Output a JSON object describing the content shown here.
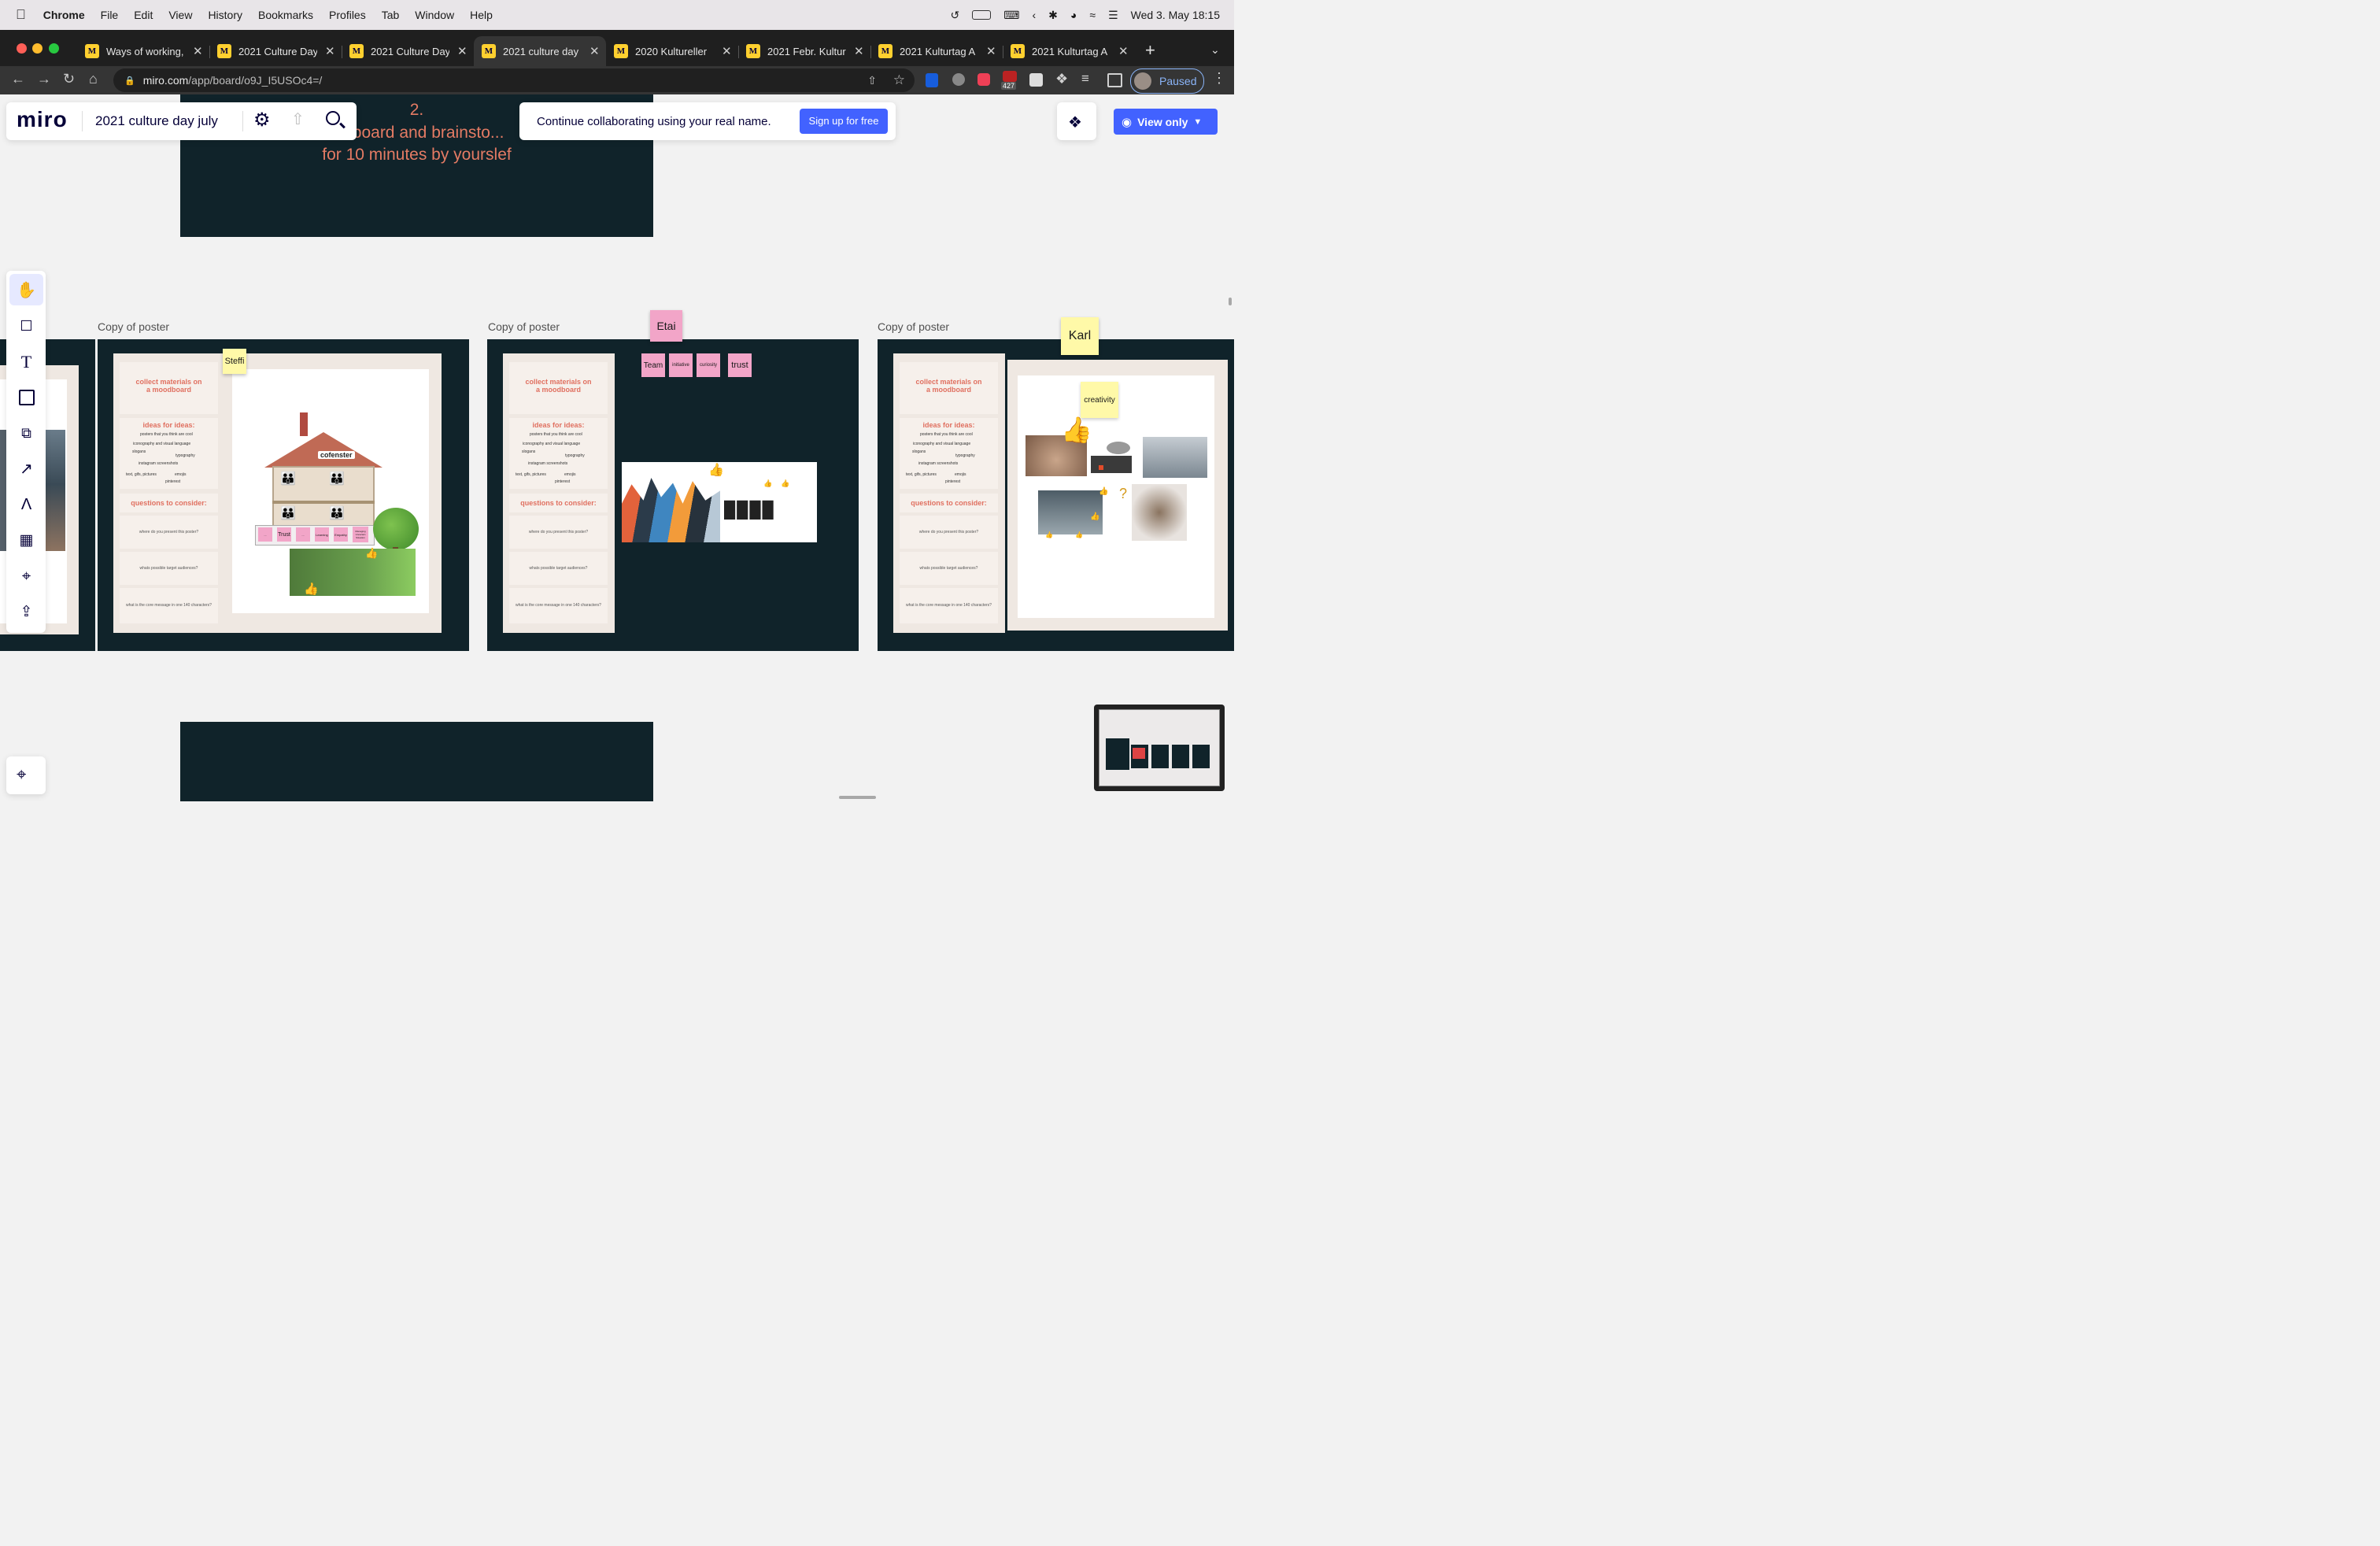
{
  "menubar": {
    "apple": "",
    "app": "Chrome",
    "items": [
      "File",
      "Edit",
      "View",
      "History",
      "Bookmarks",
      "Profiles",
      "Tab",
      "Window",
      "Help"
    ],
    "clock": "Wed 3. May  18:15"
  },
  "tabs": [
    {
      "title": "Ways of working,",
      "active": false
    },
    {
      "title": "2021 Culture Day",
      "active": false
    },
    {
      "title": "2021 Culture Day",
      "active": false
    },
    {
      "title": "2021 culture day",
      "active": true
    },
    {
      "title": "2020 Kultureller ",
      "active": false
    },
    {
      "title": "2021 Febr. Kultur",
      "active": false
    },
    {
      "title": "2021 Kulturtag A",
      "active": false
    },
    {
      "title": "2021 Kulturtag A",
      "active": false
    }
  ],
  "browser": {
    "url_host": "miro.com",
    "url_path": "/app/board/o9J_I5USOc4=/",
    "badge_count": "427",
    "profile_label": "Paused"
  },
  "miro": {
    "logo": "miro",
    "board_title": "2021 culture day july",
    "banner_text": "Continue collaborating using your real name.",
    "signup_label": "Sign up for free",
    "view_only_label": "View only",
    "top_frame_text_line1": "2.",
    "top_frame_text_line2": "...dboard and brainsto...",
    "top_frame_text_line3": "for 10 minutes by yourslef"
  },
  "posters": [
    {
      "label": "Copy of poster",
      "sticky": "Steffi"
    },
    {
      "label": "Copy of poster",
      "sticky": "Etai"
    },
    {
      "label": "Copy of poster",
      "sticky": "Karl"
    }
  ],
  "poster_cells": {
    "collect": "collect materials on a moodboard",
    "ideas": "ideas for ideas:",
    "ideas_items": [
      "posters that you think are cool",
      "iconography and visual language",
      "slogans",
      "typography",
      "instagram screenshots",
      "text, gifs, pictures",
      "emojis",
      "pinterest"
    ],
    "questions": "questions to consider:",
    "q1": "where do you present this poster?",
    "q2": "whats possible target audiences?",
    "q3": "what is the core message in one 140 characters?"
  },
  "stickies_small": {
    "steffi_house": [
      "...",
      "Trust",
      "...",
      "Learning",
      "Empathy",
      "Managing Uncertain Situation"
    ],
    "house_brand": "cofenster",
    "etai_row": [
      "Team",
      "initiative",
      "curiosity",
      "trust"
    ],
    "karl_note": "creativity"
  },
  "colors": {
    "dark_frame": "#10232a",
    "poster_bg": "#efe8e2",
    "accent_red": "#e07060",
    "miro_blue": "#4262ff",
    "sticky_yellow": "#fff9a8",
    "sticky_pink": "#f2a5c8"
  },
  "icons": [
    "hand-icon",
    "comment-icon",
    "text-icon",
    "sticky-note-icon",
    "shapes-icon",
    "arrow-icon",
    "pen-icon",
    "template-icon",
    "frame-icon",
    "upload-icon",
    "settings-icon",
    "share-icon",
    "search-icon",
    "apps-icon",
    "eye-icon"
  ]
}
